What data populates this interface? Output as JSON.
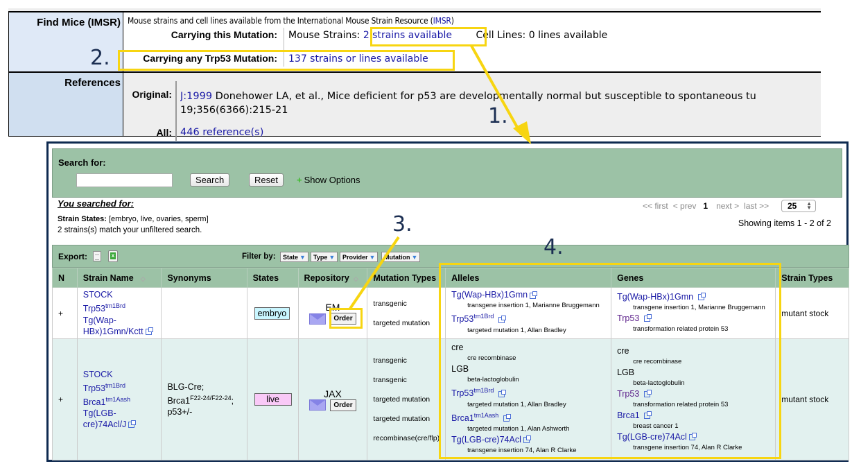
{
  "mgi": {
    "imsr": {
      "label": "Find Mice (IMSR)",
      "intro_prefix": "Mouse strains and cell lines available from the International Mouse Strain Resource (",
      "intro_link": "IMSR",
      "intro_suffix": ")",
      "carrying_this_label": "Carrying this Mutation:",
      "mouse_strains_label": "Mouse Strains:",
      "mouse_strains_link": "2 strains available",
      "cell_lines": "Cell Lines: 0 lines available",
      "carrying_any_label": "Carrying any Trp53 Mutation:",
      "carrying_any_link": "137 strains or lines available"
    },
    "references": {
      "label": "References",
      "original_label": "Original:",
      "original_link": "J:1999",
      "original_text": " Donehower LA, et al., Mice deficient for p53 are developmentally normal but susceptible to spontaneous tu",
      "original_line2": "19;356(6366):215-21",
      "all_label": "All:",
      "all_link": "446 reference(s)"
    }
  },
  "search": {
    "label": "Search for:",
    "input_value": "",
    "search_button": "Search",
    "reset_button": "Reset",
    "show_options": "Show Options",
    "you_searched_for": "You searched for:",
    "strain_states_label": "Strain States:",
    "strain_states_value": "[embryo, live, ovaries, sperm]",
    "match_count": "2 strains(s) match your unfiltered search."
  },
  "pager": {
    "first": "<< first",
    "prev": "< prev",
    "current": "1",
    "next": "next >",
    "last": "last >>",
    "page_size": "25",
    "showing": "Showing items 1 - 2 of 2"
  },
  "toolbar": {
    "export_label": "Export:",
    "filter_label": "Filter by:",
    "filters": [
      "State",
      "Type",
      "Provider",
      "Mutation"
    ]
  },
  "table": {
    "columns": [
      "N",
      "Strain Name",
      "Synonyms",
      "States",
      "Repository",
      "Mutation Types",
      "Alleles",
      "Genes",
      "Strain Types"
    ],
    "rows": [
      {
        "n": "+",
        "strain_name": {
          "l1": "STOCK",
          "l2": "Trp53",
          "l2_sup": "tm1Brd",
          "l3": "Tg(Wap-",
          "l4": "HBx)1Gmn/Kctt"
        },
        "synonyms": "",
        "state": "embryo",
        "repository": "EM",
        "order": "Order",
        "mutation_types": [
          "transgenic",
          "targeted mutation"
        ],
        "alleles": [
          {
            "name": "Tg(Wap-HBx)1Gmn",
            "sup": "",
            "desc": "transgene insertion 1, Marianne Bruggemann"
          },
          {
            "name": "Trp53",
            "sup": "tm1Brd",
            "desc": "targeted mutation 1, Allan Bradley"
          }
        ],
        "genes": [
          {
            "name": "Tg(Wap-HBx)1Gmn",
            "desc": "transgene insertion 1, Marianne Bruggemann"
          },
          {
            "name": "Trp53",
            "desc": "transformation related protein 53"
          }
        ],
        "strain_type": "mutant stock"
      },
      {
        "n": "+",
        "strain_name": {
          "l1": "STOCK",
          "l2": "Trp53",
          "l2_sup": "tm1Brd",
          "l3": "Brca1",
          "l3_sup": "tm1Aash",
          "l4": "Tg(LGB-",
          "l5": "cre)74Acl/J"
        },
        "synonyms": {
          "l1": "BLG-Cre;",
          "l2": "Brca1",
          "l2_sup": "F22-24/F22-24",
          "l2_suffix": ";",
          "l3": "p53+/-"
        },
        "state": "live",
        "repository": "JAX",
        "order": "Order",
        "mutation_types": [
          "transgenic",
          "transgenic",
          "targeted mutation",
          "targeted mutation",
          "recombinase(cre/flp)"
        ],
        "alleles": [
          {
            "name": "cre",
            "sup": "",
            "desc": "cre recombinase"
          },
          {
            "name": "LGB",
            "sup": "",
            "desc": "beta-lactoglobulin"
          },
          {
            "name": "Trp53",
            "sup": "tm1Brd",
            "desc": "targeted mutation 1, Allan Bradley"
          },
          {
            "name": "Brca1",
            "sup": "tm1Aash",
            "desc": "targeted mutation 1, Alan Ashworth"
          },
          {
            "name": "Tg(LGB-cre)74Acl",
            "sup": "",
            "desc": "transgene insertion 74, Alan R Clarke"
          }
        ],
        "genes": [
          {
            "name": "cre",
            "desc": "cre recombinase"
          },
          {
            "name": "LGB",
            "desc": "beta-lactoglobulin"
          },
          {
            "name": "Trp53",
            "desc": "transformation related protein 53"
          },
          {
            "name": "Brca1",
            "desc": "breast cancer 1"
          },
          {
            "name": "Tg(LGB-cre)74Acl",
            "desc": "transgene insertion 74, Alan R Clarke"
          }
        ],
        "strain_type": "mutant stock"
      }
    ]
  },
  "annotations": {
    "n1": "1.",
    "n2": "2.",
    "n3": "3.",
    "n4": "4.",
    "highlight_color": "#f7d511",
    "number_color": "#1b2e52"
  }
}
